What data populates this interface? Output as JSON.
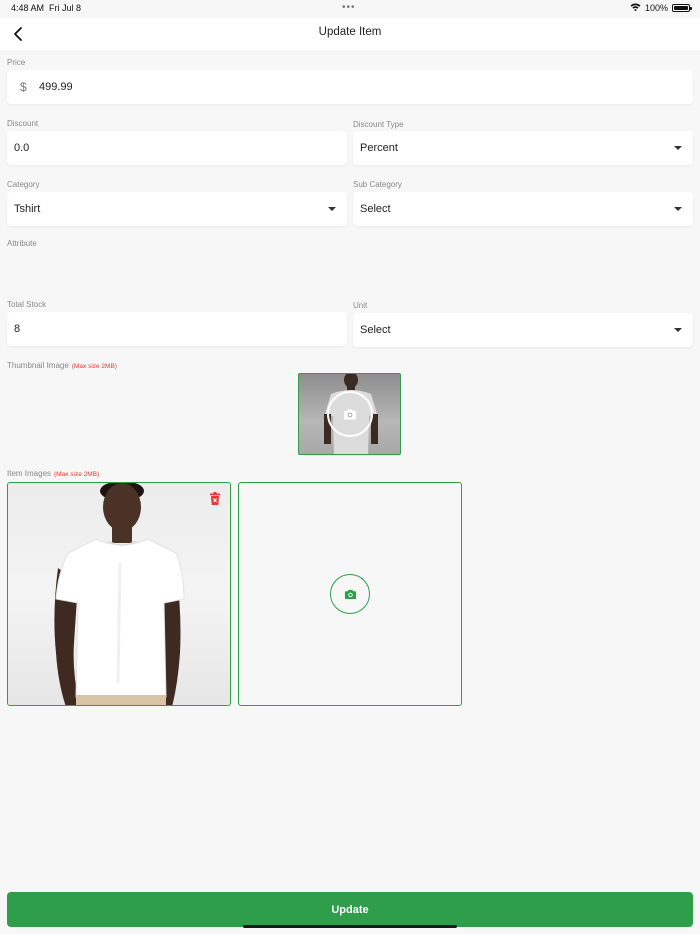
{
  "status_bar": {
    "time": "4:48 AM",
    "date": "Fri Jul 8",
    "dots": "•••",
    "battery": "100%",
    "wifi_icon": "wifi-icon",
    "battery_icon": "battery-icon"
  },
  "header": {
    "title": "Update Item",
    "back_icon": "chevron-left-icon"
  },
  "form": {
    "price": {
      "label": "Price",
      "currency": "$",
      "value": "499.99"
    },
    "discount": {
      "label": "Discount",
      "value": "0.0"
    },
    "discount_type": {
      "label": "Discount Type",
      "value": "Percent"
    },
    "category": {
      "label": "Category",
      "value": "Tshirt"
    },
    "sub_category": {
      "label": "Sub Category",
      "value": "Select"
    },
    "attribute": {
      "label": "Attribute"
    },
    "total_stock": {
      "label": "Total Stock",
      "value": "8"
    },
    "unit": {
      "label": "Unit",
      "value": "Select"
    }
  },
  "thumbnail": {
    "label": "Thumbnail Image",
    "max_size": "(Max size 2MB)",
    "icon": "camera-icon"
  },
  "item_images": {
    "label": "Item Images",
    "max_size": "(Max size 2MB)",
    "delete_icon": "trash-icon",
    "add_icon": "camera-icon"
  },
  "actions": {
    "update_label": "Update"
  },
  "colors": {
    "accent": "#2e9e4a",
    "danger": "#e53935",
    "background": "#f7f7f7"
  }
}
